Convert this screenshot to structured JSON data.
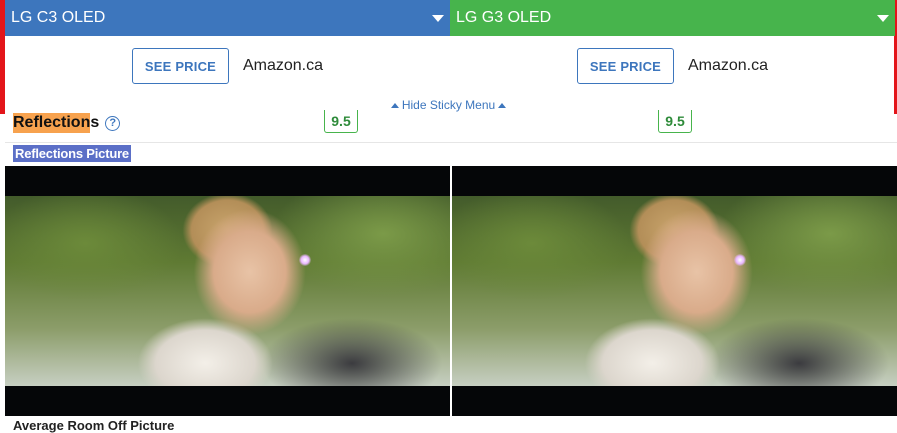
{
  "compare": {
    "left": {
      "product": "LG C3 OLED",
      "price_button": "SEE PRICE",
      "store": "Amazon.ca",
      "reflections_score": "9.5"
    },
    "right": {
      "product": "LG G3 OLED",
      "price_button": "SEE PRICE",
      "store": "Amazon.ca",
      "reflections_score": "9.5"
    }
  },
  "sticky": {
    "hide_label": "Hide Sticky Menu"
  },
  "section": {
    "reflections_highlight": "Reflection",
    "reflections_suffix": "s",
    "help_symbol": "?",
    "picture_title": "Reflections Picture",
    "next_title": "Average Room Off Picture"
  },
  "colors": {
    "left_brand": "#3d76bd",
    "right_brand": "#47b44c",
    "accent_red": "#e3151a",
    "highlight": "#f7a24e"
  }
}
